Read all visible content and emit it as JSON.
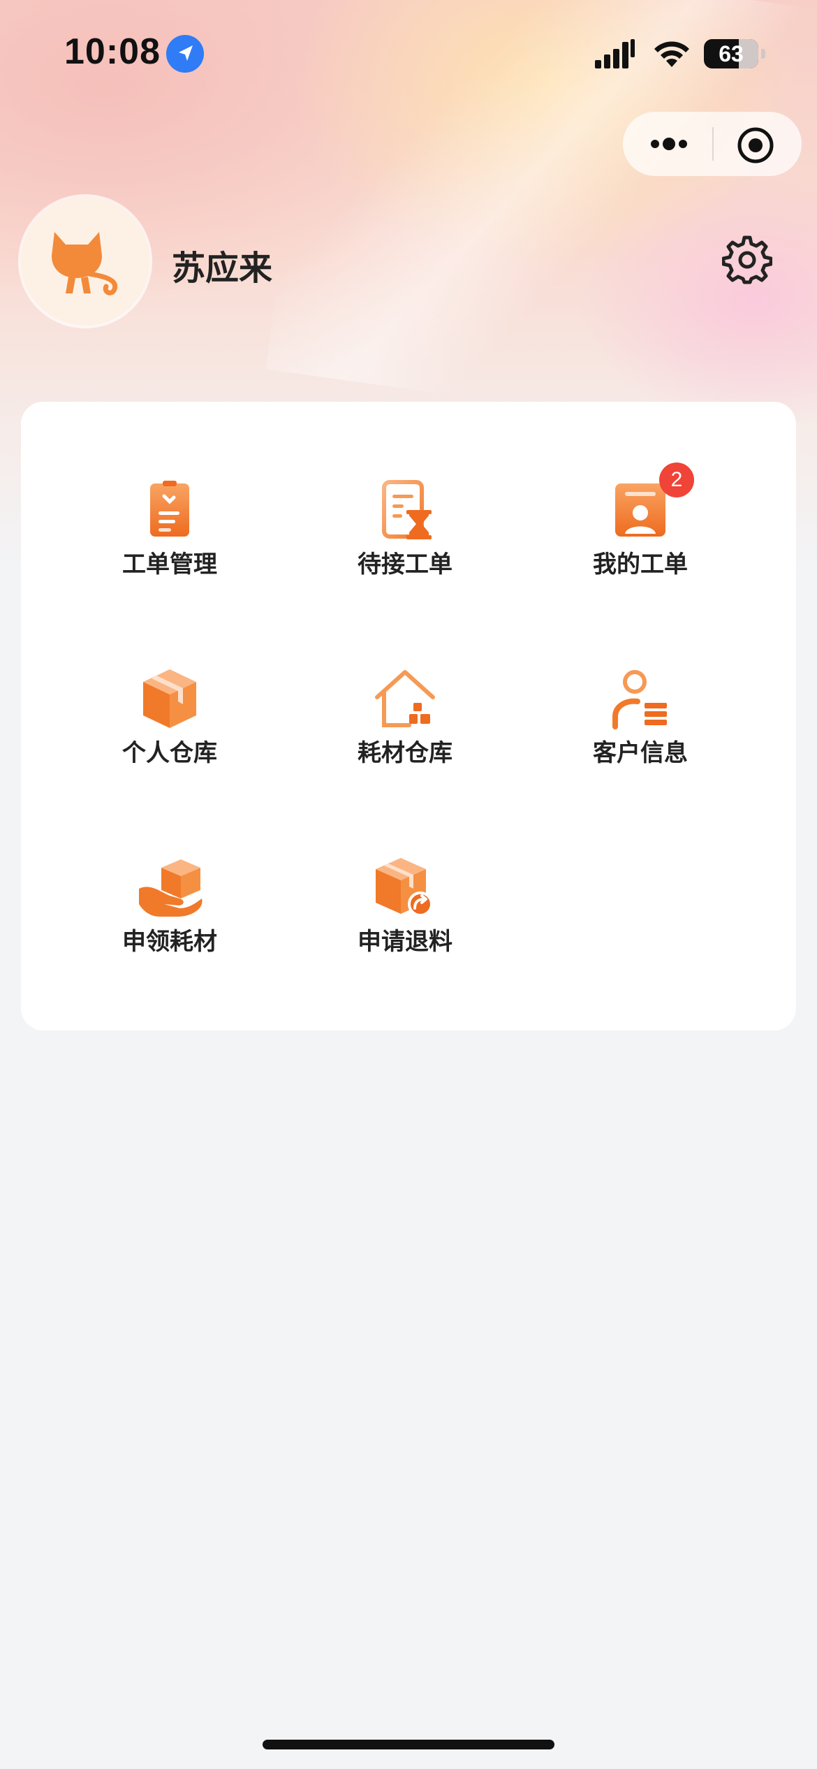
{
  "status_bar": {
    "time": "10:08",
    "battery": "63",
    "icons": [
      "location-arrow-icon",
      "cellular-signal-icon",
      "wifi-icon",
      "battery-icon"
    ]
  },
  "capsule": {
    "icons": [
      "more-dots-icon",
      "close-target-icon"
    ]
  },
  "profile": {
    "name": "苏应来",
    "avatar_icon": "cat-avatar-icon",
    "settings_icon": "gear-icon"
  },
  "menu": {
    "items": [
      {
        "label": "工单管理",
        "icon": "work-order-clipboard-icon"
      },
      {
        "label": "待接工单",
        "icon": "pending-order-hourglass-icon"
      },
      {
        "label": "我的工单",
        "icon": "my-order-badge-icon",
        "badge": "2"
      },
      {
        "label": "个人仓库",
        "icon": "personal-box-icon"
      },
      {
        "label": "耗材仓库",
        "icon": "warehouse-house-icon"
      },
      {
        "label": "客户信息",
        "icon": "customer-info-icon"
      },
      {
        "label": "申领耗材",
        "icon": "hand-box-icon"
      },
      {
        "label": "申请退料",
        "icon": "return-box-icon"
      }
    ]
  },
  "colors": {
    "accent": "#f07a2a",
    "accent_light": "#f9a463",
    "badge": "#ef4437",
    "page_bg": "#f3f4f6"
  }
}
